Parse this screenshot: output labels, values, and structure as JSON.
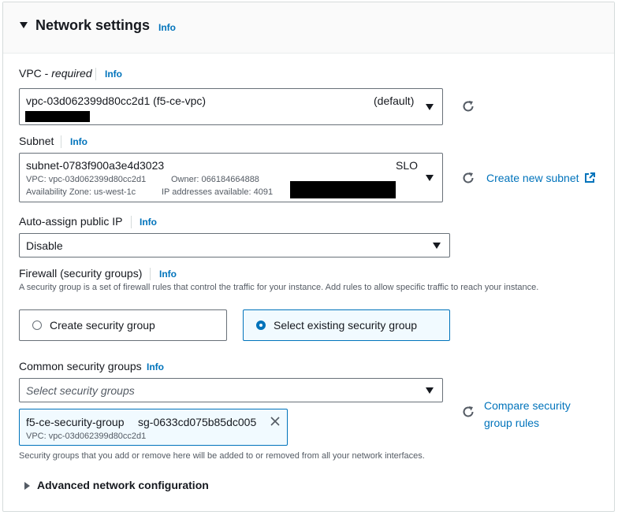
{
  "section": {
    "title": "Network settings",
    "info": "Info"
  },
  "vpc": {
    "label": "VPC",
    "required": "required",
    "label_sep": " - ",
    "info": "Info",
    "value": "vpc-03d062399d80cc2d1 (f5-ce-vpc)",
    "tag": "(default)"
  },
  "subnet": {
    "label": "Subnet",
    "info": "Info",
    "value": "subnet-0783f900a3e4d3023",
    "tag": "SLO",
    "vpc_line": "VPC: vpc-03d062399d80cc2d1",
    "owner_line": "Owner: 066184664888",
    "az_line": "Availability Zone: us-west-1c",
    "ip_line": "IP addresses available: 4091",
    "create_link": "Create new subnet"
  },
  "public_ip": {
    "label": "Auto-assign public IP",
    "info": "Info",
    "value": "Disable"
  },
  "firewall": {
    "label": "Firewall (security groups)",
    "info": "Info",
    "description": "A security group is a set of firewall rules that control the traffic for your instance. Add rules to allow specific traffic to reach your instance.",
    "option_create": "Create security group",
    "option_select": "Select existing security group",
    "selected": "Select existing security group"
  },
  "common_sg": {
    "label": "Common security groups",
    "info": "Info",
    "placeholder": "Select security groups",
    "token_name": "f5-ce-security-group",
    "token_id": "sg-0633cd075b85dc005",
    "token_vpc": "VPC: vpc-03d062399d80cc2d1",
    "compare_line1": "Compare security",
    "compare_line2": "group rules",
    "help": "Security groups that you add or remove here will be added to or removed from all your network interfaces."
  },
  "advanced": {
    "label": "Advanced network configuration"
  },
  "icons": {
    "expand": "caret-down-icon",
    "collapse": "caret-right-icon",
    "refresh": "refresh-icon",
    "external": "external-link-icon",
    "remove": "close-icon"
  },
  "colors": {
    "link": "#0073bb",
    "border": "#687078",
    "selected_bg": "#f1faff"
  }
}
